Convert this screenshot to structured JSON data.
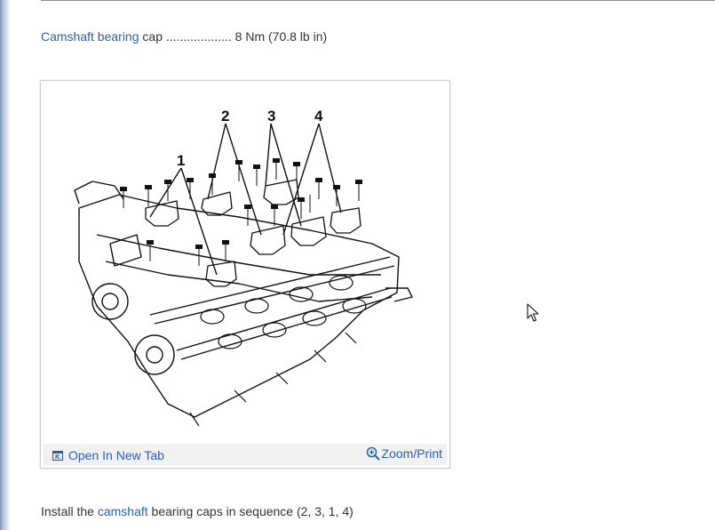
{
  "spec": {
    "link_text": "Camshaft bearing",
    "rest_text": " cap ................... 8 Nm (70.8 lb in)"
  },
  "figure": {
    "callouts": [
      "1",
      "2",
      "3",
      "4"
    ],
    "open_tab_label": "Open In New Tab",
    "zoom_print_label": "Zoom/Print",
    "icons": [
      "open-tab-icon",
      "zoom-in-icon"
    ]
  },
  "instruction": {
    "prefix": "Install the ",
    "link_text": "camshaft",
    "suffix": " bearing caps in sequence (2, 3, 1, 4)"
  }
}
